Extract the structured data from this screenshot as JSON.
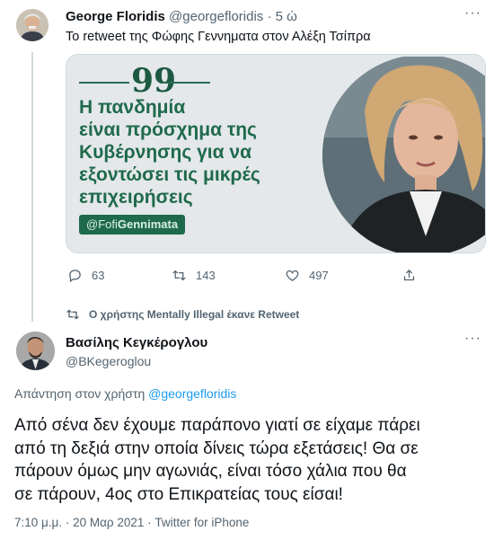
{
  "tweet1": {
    "author_name": "George Floridis",
    "author_handle": "@georgefloridis",
    "separator": "·",
    "time": "5 ώ",
    "text": "Το retweet της  Φώφης Γεννηματα στον Αλέξη Τσίπρα",
    "card": {
      "quote_symbol": "99",
      "headline_lines": [
        "Η πανδημία",
        "είναι πρόσχημα της",
        "Κυβέρνησης για να",
        "εξοντώσει τις μικρές",
        "επιχειρήσεις"
      ],
      "tag_prefix": "@Fofi",
      "tag_suffix": "Gennimata"
    },
    "actions": {
      "replies": "63",
      "retweets": "143",
      "likes": "497"
    }
  },
  "retweet_notice": "Ο χρήστης Mentally Illegal έκανε Retweet",
  "tweet2": {
    "author_name": "Βασίλης Κεγκέρογλου",
    "author_handle": "@BKegeroglou",
    "reply_prefix": "Απάντηση στον χρήστη",
    "reply_mention": "@georgefloridis",
    "body_lines": [
      "Από σένα δεν έχουμε παράπονο γιατί σε είχαμε πάρει",
      "από τη δεξιά στην οποία δίνεις τώρα εξετάσεις! Θα σε",
      "πάρουν όμως μην αγωνιάς, είναι τόσο χάλια που θα",
      "σε πάρουν, 4ος στο Επικρατείας τους είσαι!"
    ],
    "timestamp": "7:10 μ.μ. · 20 Μαρ 2021 · Twitter for iPhone"
  },
  "more_glyph": "···",
  "colors": {
    "text": "#0f1419",
    "muted": "#536471",
    "link": "#1d9bf0",
    "card_green": "#1f6a4c",
    "border": "#cfd9de"
  },
  "icons": [
    "reply-icon",
    "retweet-icon",
    "like-icon",
    "share-icon",
    "more-icon"
  ]
}
